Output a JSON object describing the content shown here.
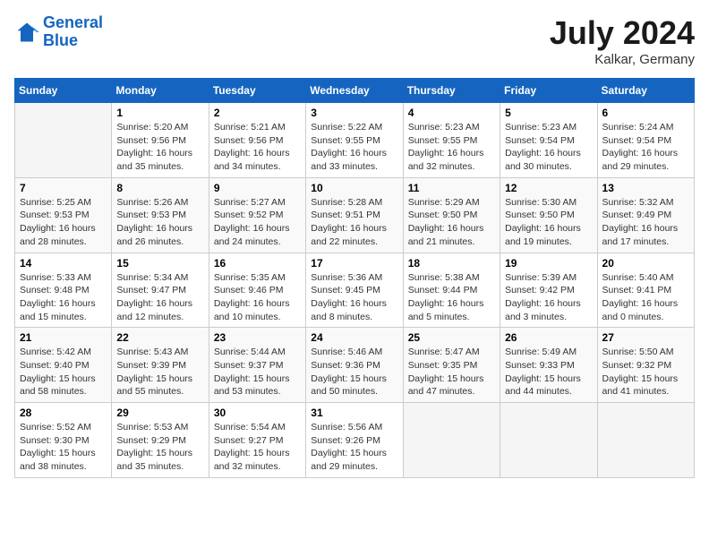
{
  "header": {
    "logo_line1": "General",
    "logo_line2": "Blue",
    "month": "July 2024",
    "location": "Kalkar, Germany"
  },
  "calendar": {
    "days_of_week": [
      "Sunday",
      "Monday",
      "Tuesday",
      "Wednesday",
      "Thursday",
      "Friday",
      "Saturday"
    ],
    "weeks": [
      [
        {
          "day": "",
          "info": ""
        },
        {
          "day": "1",
          "info": "Sunrise: 5:20 AM\nSunset: 9:56 PM\nDaylight: 16 hours\nand 35 minutes."
        },
        {
          "day": "2",
          "info": "Sunrise: 5:21 AM\nSunset: 9:56 PM\nDaylight: 16 hours\nand 34 minutes."
        },
        {
          "day": "3",
          "info": "Sunrise: 5:22 AM\nSunset: 9:55 PM\nDaylight: 16 hours\nand 33 minutes."
        },
        {
          "day": "4",
          "info": "Sunrise: 5:23 AM\nSunset: 9:55 PM\nDaylight: 16 hours\nand 32 minutes."
        },
        {
          "day": "5",
          "info": "Sunrise: 5:23 AM\nSunset: 9:54 PM\nDaylight: 16 hours\nand 30 minutes."
        },
        {
          "day": "6",
          "info": "Sunrise: 5:24 AM\nSunset: 9:54 PM\nDaylight: 16 hours\nand 29 minutes."
        }
      ],
      [
        {
          "day": "7",
          "info": "Sunrise: 5:25 AM\nSunset: 9:53 PM\nDaylight: 16 hours\nand 28 minutes."
        },
        {
          "day": "8",
          "info": "Sunrise: 5:26 AM\nSunset: 9:53 PM\nDaylight: 16 hours\nand 26 minutes."
        },
        {
          "day": "9",
          "info": "Sunrise: 5:27 AM\nSunset: 9:52 PM\nDaylight: 16 hours\nand 24 minutes."
        },
        {
          "day": "10",
          "info": "Sunrise: 5:28 AM\nSunset: 9:51 PM\nDaylight: 16 hours\nand 22 minutes."
        },
        {
          "day": "11",
          "info": "Sunrise: 5:29 AM\nSunset: 9:50 PM\nDaylight: 16 hours\nand 21 minutes."
        },
        {
          "day": "12",
          "info": "Sunrise: 5:30 AM\nSunset: 9:50 PM\nDaylight: 16 hours\nand 19 minutes."
        },
        {
          "day": "13",
          "info": "Sunrise: 5:32 AM\nSunset: 9:49 PM\nDaylight: 16 hours\nand 17 minutes."
        }
      ],
      [
        {
          "day": "14",
          "info": "Sunrise: 5:33 AM\nSunset: 9:48 PM\nDaylight: 16 hours\nand 15 minutes."
        },
        {
          "day": "15",
          "info": "Sunrise: 5:34 AM\nSunset: 9:47 PM\nDaylight: 16 hours\nand 12 minutes."
        },
        {
          "day": "16",
          "info": "Sunrise: 5:35 AM\nSunset: 9:46 PM\nDaylight: 16 hours\nand 10 minutes."
        },
        {
          "day": "17",
          "info": "Sunrise: 5:36 AM\nSunset: 9:45 PM\nDaylight: 16 hours\nand 8 minutes."
        },
        {
          "day": "18",
          "info": "Sunrise: 5:38 AM\nSunset: 9:44 PM\nDaylight: 16 hours\nand 5 minutes."
        },
        {
          "day": "19",
          "info": "Sunrise: 5:39 AM\nSunset: 9:42 PM\nDaylight: 16 hours\nand 3 minutes."
        },
        {
          "day": "20",
          "info": "Sunrise: 5:40 AM\nSunset: 9:41 PM\nDaylight: 16 hours\nand 0 minutes."
        }
      ],
      [
        {
          "day": "21",
          "info": "Sunrise: 5:42 AM\nSunset: 9:40 PM\nDaylight: 15 hours\nand 58 minutes."
        },
        {
          "day": "22",
          "info": "Sunrise: 5:43 AM\nSunset: 9:39 PM\nDaylight: 15 hours\nand 55 minutes."
        },
        {
          "day": "23",
          "info": "Sunrise: 5:44 AM\nSunset: 9:37 PM\nDaylight: 15 hours\nand 53 minutes."
        },
        {
          "day": "24",
          "info": "Sunrise: 5:46 AM\nSunset: 9:36 PM\nDaylight: 15 hours\nand 50 minutes."
        },
        {
          "day": "25",
          "info": "Sunrise: 5:47 AM\nSunset: 9:35 PM\nDaylight: 15 hours\nand 47 minutes."
        },
        {
          "day": "26",
          "info": "Sunrise: 5:49 AM\nSunset: 9:33 PM\nDaylight: 15 hours\nand 44 minutes."
        },
        {
          "day": "27",
          "info": "Sunrise: 5:50 AM\nSunset: 9:32 PM\nDaylight: 15 hours\nand 41 minutes."
        }
      ],
      [
        {
          "day": "28",
          "info": "Sunrise: 5:52 AM\nSunset: 9:30 PM\nDaylight: 15 hours\nand 38 minutes."
        },
        {
          "day": "29",
          "info": "Sunrise: 5:53 AM\nSunset: 9:29 PM\nDaylight: 15 hours\nand 35 minutes."
        },
        {
          "day": "30",
          "info": "Sunrise: 5:54 AM\nSunset: 9:27 PM\nDaylight: 15 hours\nand 32 minutes."
        },
        {
          "day": "31",
          "info": "Sunrise: 5:56 AM\nSunset: 9:26 PM\nDaylight: 15 hours\nand 29 minutes."
        },
        {
          "day": "",
          "info": ""
        },
        {
          "day": "",
          "info": ""
        },
        {
          "day": "",
          "info": ""
        }
      ]
    ]
  }
}
